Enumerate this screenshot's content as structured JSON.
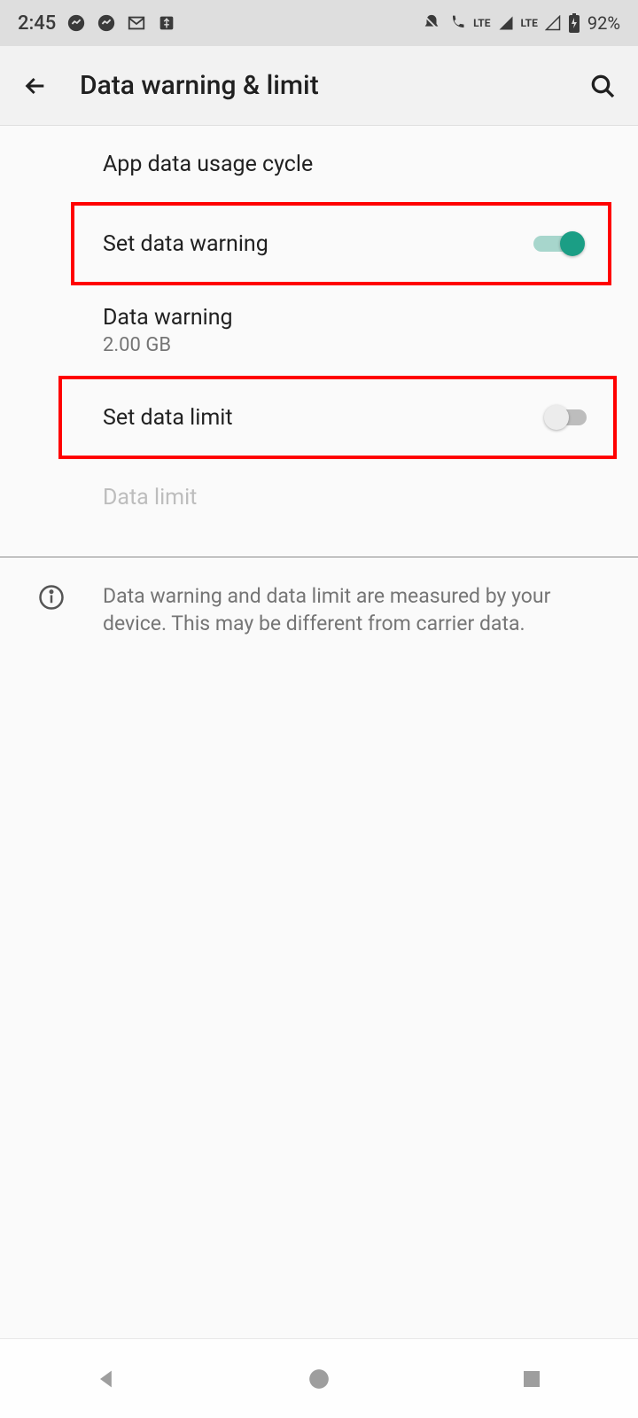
{
  "status": {
    "time": "2:45",
    "battery_pct": "92%"
  },
  "header": {
    "title": "Data warning & limit"
  },
  "settings": {
    "usage_cycle_label": "App data usage cycle",
    "set_warning_label": "Set data warning",
    "set_warning_on": true,
    "data_warning_label": "Data warning",
    "data_warning_value": "2.00 GB",
    "set_limit_label": "Set data limit",
    "set_limit_on": false,
    "data_limit_label": "Data limit"
  },
  "footer": {
    "note": "Data warning and data limit are measured by your device. This may be different from carrier data."
  }
}
